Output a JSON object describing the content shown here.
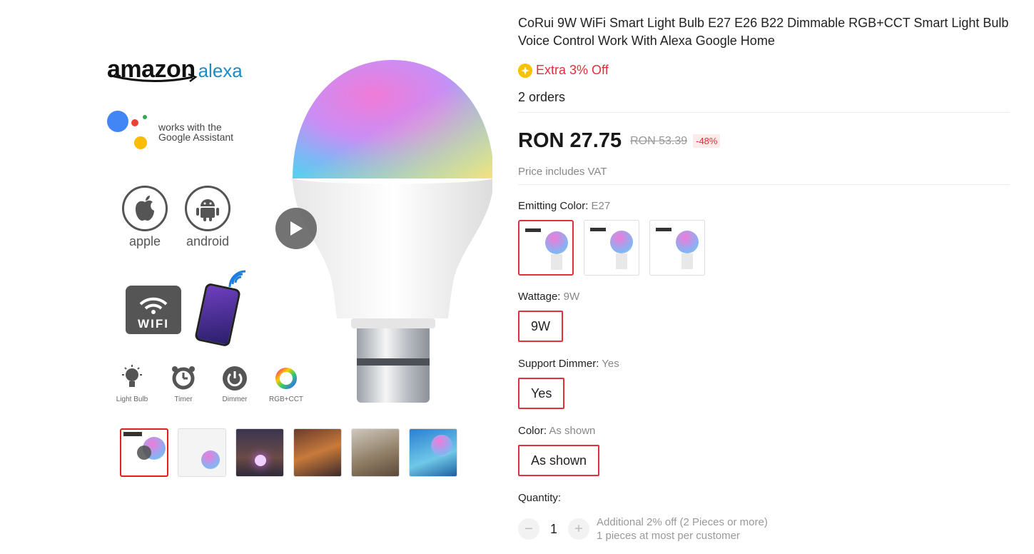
{
  "gallery": {
    "brand_amazon": "amazon",
    "brand_alexa": "alexa",
    "google_assistant_text": "works with the Google Assistant",
    "os_apple": "apple",
    "os_android": "android",
    "wifi_label": "WIFI",
    "features": [
      "Light Bulb",
      "Timer",
      "Dimmer",
      "RGB+CCT"
    ],
    "thumbnail_count": 6,
    "active_thumbnail": 0
  },
  "product": {
    "title": "CoRui 9W WiFi Smart Light Bulb E27 E26 B22 Dimmable RGB+CCT Smart Light Bulb Voice Control Work With Alexa Google Home",
    "extra_off": "Extra 3% Off",
    "orders": "2 orders",
    "price": "RON 27.75",
    "old_price": "RON 53.39",
    "discount": "-48%",
    "vat_note": "Price includes VAT"
  },
  "options": {
    "emitting_color": {
      "label": "Emitting Color:",
      "value": "E27"
    },
    "wattage": {
      "label": "Wattage:",
      "value": "9W",
      "chip": "9W"
    },
    "support_dimmer": {
      "label": "Support Dimmer:",
      "value": "Yes",
      "chip": "Yes"
    },
    "color": {
      "label": "Color:",
      "value": "As shown",
      "chip": "As shown"
    }
  },
  "quantity": {
    "label": "Quantity:",
    "value": "1",
    "minus": "−",
    "plus": "+",
    "note_line1": "Additional 2% off (2 Pieces or more)",
    "note_line2": "1 pieces at most per customer"
  },
  "colors": {
    "accent": "#e0303a",
    "coin": "#f9c200"
  }
}
